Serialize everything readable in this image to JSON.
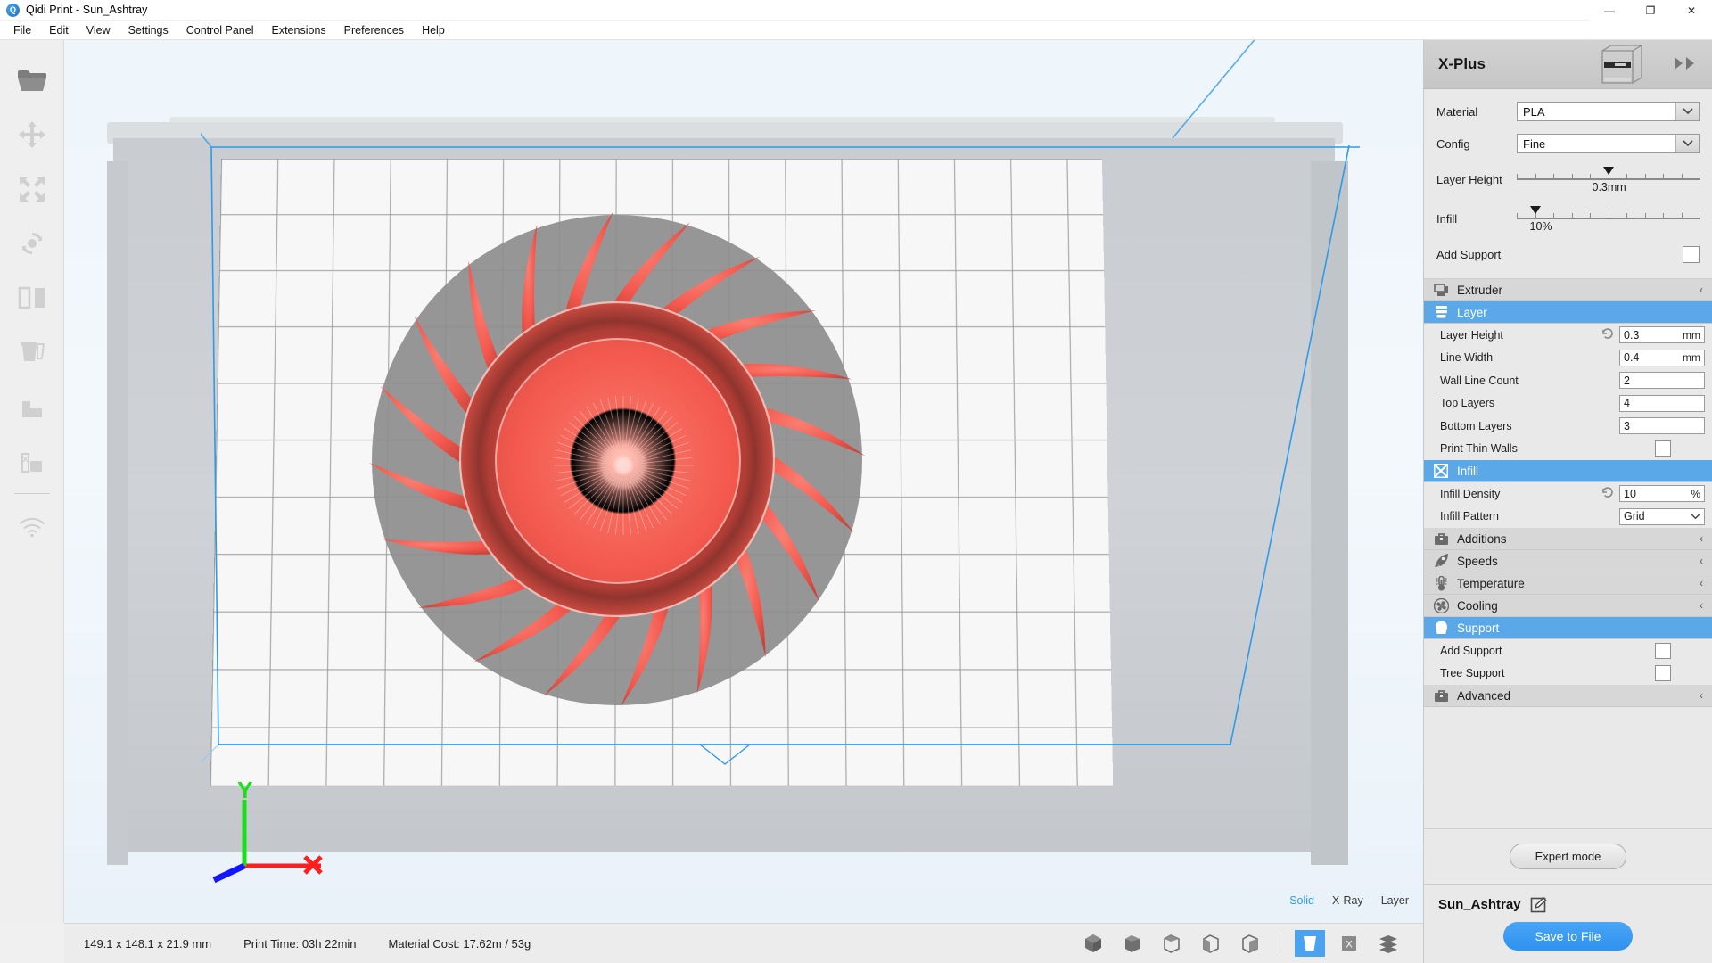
{
  "window": {
    "title": "Qidi Print - Sun_Ashtray",
    "app_icon": "qidi-logo-icon",
    "minimize": "—",
    "maximize": "❐",
    "close": "✕"
  },
  "menubar": {
    "items": [
      "File",
      "Edit",
      "View",
      "Settings",
      "Control Panel",
      "Extensions",
      "Preferences",
      "Help"
    ]
  },
  "toolrail": {
    "items": [
      {
        "name": "open-file-icon",
        "label": "Open File"
      },
      {
        "name": "move-icon",
        "label": "Move"
      },
      {
        "name": "scale-icon",
        "label": "Scale"
      },
      {
        "name": "rotate-icon",
        "label": "Rotate"
      },
      {
        "name": "mirror-icon",
        "label": "Mirror"
      },
      {
        "name": "per-model-settings-icon",
        "label": "Per Model Settings"
      },
      {
        "name": "support-blocker-icon",
        "label": "Support Blocker"
      },
      {
        "name": "support-eraser-icon",
        "label": "Support Eraser"
      },
      {
        "name": "wifi-icon",
        "label": "Wifi Connection"
      }
    ]
  },
  "viewport": {
    "axis": {
      "x_label": "X",
      "y_label": "Y",
      "z_label": ""
    },
    "view_modes": [
      {
        "label": "Solid",
        "active": true
      },
      {
        "label": "X-Ray",
        "active": false
      },
      {
        "label": "Layer",
        "active": false
      }
    ],
    "model_color": "#f4594e",
    "plate_color": "#f7f7f7",
    "build_volume_color": "#2f9ae8"
  },
  "statusbar": {
    "dimensions": "149.1 x 148.1 x 21.9 mm",
    "print_time": "Print Time: 03h 22min",
    "material_cost": "Material Cost: 17.62m / 53g",
    "view_icons": [
      {
        "name": "view-3d-icon"
      },
      {
        "name": "view-front-icon"
      },
      {
        "name": "view-top-icon"
      },
      {
        "name": "view-left-icon"
      },
      {
        "name": "view-right-icon"
      },
      {
        "name": "view-solid-icon",
        "selected": true
      },
      {
        "name": "view-xray-icon",
        "label": "X"
      },
      {
        "name": "view-layers-icon"
      }
    ]
  },
  "rightpanel": {
    "printer_name": "X-Plus",
    "printer_image": "printer-thumbnail-icon",
    "collapse_icon": "double-chevron-right-icon",
    "quick": {
      "material": {
        "label": "Material",
        "value": "PLA"
      },
      "config": {
        "label": "Config",
        "value": "Fine"
      },
      "layer_height": {
        "label": "Layer Height",
        "value": "0.3mm",
        "thumb_pct": 50,
        "ticks": 11
      },
      "infill": {
        "label": "Infill",
        "value": "10%",
        "thumb_pct": 10,
        "ticks": 11
      },
      "add_support": {
        "label": "Add Support",
        "checked": false
      }
    },
    "sections": [
      {
        "name": "extruder",
        "title": "Extruder",
        "icon": "extruder-icon",
        "open": false,
        "chevron": "‹",
        "rows": []
      },
      {
        "name": "layer",
        "title": "Layer",
        "icon": "layer-icon",
        "open": true,
        "chevron": "ⱟ",
        "rows": [
          {
            "label": "Layer Height",
            "value": "0.3",
            "unit": "mm",
            "type": "text",
            "reset": true
          },
          {
            "label": "Line Width",
            "value": "0.4",
            "unit": "mm",
            "type": "text",
            "reset": false
          },
          {
            "label": "Wall Line Count",
            "value": "2",
            "unit": "",
            "type": "text",
            "reset": false
          },
          {
            "label": "Top Layers",
            "value": "4",
            "unit": "",
            "type": "text",
            "reset": false
          },
          {
            "label": "Bottom Layers",
            "value": "3",
            "unit": "",
            "type": "text",
            "reset": false
          },
          {
            "label": "Print Thin Walls",
            "value": "",
            "unit": "",
            "type": "check",
            "checked": false,
            "reset": false
          }
        ]
      },
      {
        "name": "infill",
        "title": "Infill",
        "icon": "infill-icon",
        "open": true,
        "chevron": "ⱟ",
        "rows": [
          {
            "label": "Infill Density",
            "value": "10",
            "unit": "%",
            "type": "text",
            "reset": true
          },
          {
            "label": "Infill Pattern",
            "value": "Grid",
            "unit": "",
            "type": "combo",
            "reset": false
          }
        ]
      },
      {
        "name": "additions",
        "title": "Additions",
        "icon": "additions-icon",
        "open": false,
        "chevron": "‹",
        "rows": []
      },
      {
        "name": "speeds",
        "title": "Speeds",
        "icon": "speeds-icon",
        "open": false,
        "chevron": "‹",
        "rows": []
      },
      {
        "name": "temperature",
        "title": "Temperature",
        "icon": "temperature-icon",
        "open": false,
        "chevron": "‹",
        "rows": []
      },
      {
        "name": "cooling",
        "title": "Cooling",
        "icon": "cooling-icon",
        "open": false,
        "chevron": "‹",
        "rows": []
      },
      {
        "name": "support",
        "title": "Support",
        "icon": "support-icon",
        "open": true,
        "chevron": "ⱟ",
        "rows": [
          {
            "label": "Add Support",
            "value": "",
            "unit": "",
            "type": "check",
            "checked": false,
            "reset": false
          },
          {
            "label": "Tree Support",
            "value": "",
            "unit": "",
            "type": "check",
            "checked": false,
            "reset": false
          }
        ]
      },
      {
        "name": "advanced",
        "title": "Advanced",
        "icon": "advanced-icon",
        "open": false,
        "chevron": "‹",
        "rows": []
      }
    ],
    "expert_mode": "Expert mode",
    "file_name": "Sun_Ashtray",
    "edit_icon": "edit-pencil-icon",
    "save_button": "Save to File"
  },
  "colors": {
    "accent_blue": "#5ba8e8",
    "save_blue": "#2f92ef",
    "panel_bg": "#e9e9e9",
    "model_red": "#f4594e"
  }
}
